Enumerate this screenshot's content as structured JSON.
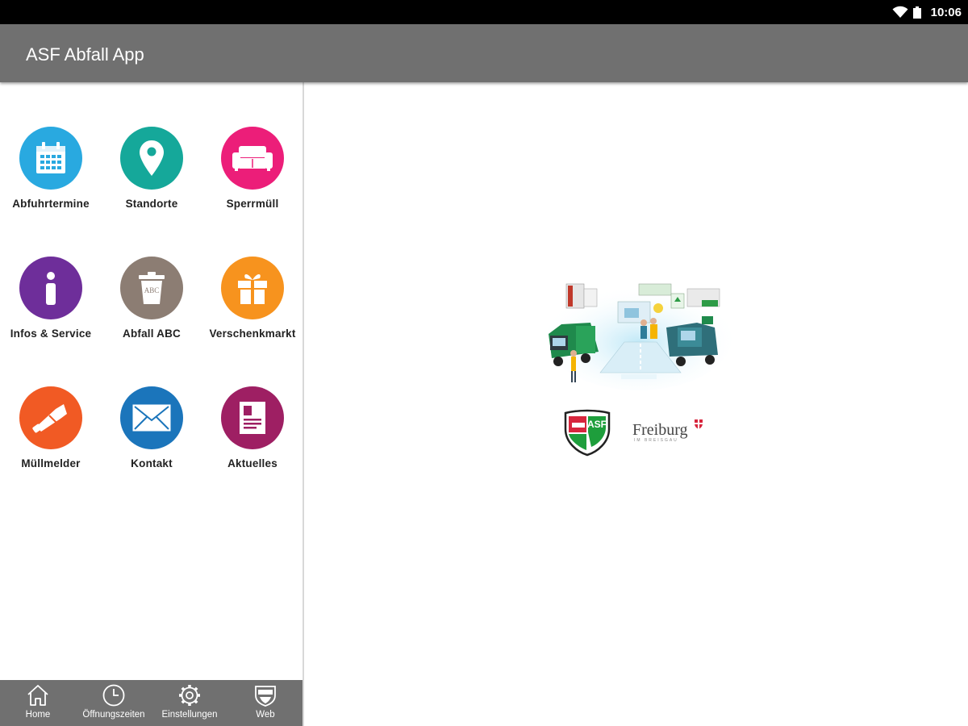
{
  "status_bar": {
    "time": "10:06",
    "icons": [
      "wifi-icon",
      "battery-icon"
    ]
  },
  "app_bar": {
    "title": "ASF Abfall App"
  },
  "menu": {
    "tiles": [
      {
        "label": "Abfuhrtermine",
        "icon": "calendar-icon",
        "color": "#29A9E0"
      },
      {
        "label": "Standorte",
        "icon": "location-pin-icon",
        "color": "#15A89A"
      },
      {
        "label": "Sperrmüll",
        "icon": "sofa-icon",
        "color": "#EC1E79"
      },
      {
        "label": "Infos & Service",
        "icon": "info-icon",
        "color": "#6E2E9A"
      },
      {
        "label": "Abfall ABC",
        "icon": "trash-bin-icon",
        "color": "#8C7D73"
      },
      {
        "label": "Verschenkmarkt",
        "icon": "gift-icon",
        "color": "#F7931E"
      },
      {
        "label": "Müllmelder",
        "icon": "megaphone-icon",
        "color": "#F15A24"
      },
      {
        "label": "Kontakt",
        "icon": "envelope-icon",
        "color": "#1B75BB"
      },
      {
        "label": "Aktuelles",
        "icon": "document-icon",
        "color": "#9E1F63"
      }
    ],
    "trash_bin_text": "ABC"
  },
  "bottom_nav": [
    {
      "label": "Home",
      "icon": "home-icon"
    },
    {
      "label": "Öffnungszeiten",
      "icon": "clock-icon"
    },
    {
      "label": "Einstellungen",
      "icon": "gear-icon"
    },
    {
      "label": "Web",
      "icon": "shield-icon"
    }
  ],
  "main": {
    "illustration": "city-waste-illustration",
    "logos": {
      "asf_text": "ASF",
      "freiburg_text": "Freiburg",
      "freiburg_sub": "IM BREISGAU"
    }
  },
  "colors": {
    "app_bar": "#707070",
    "status_bar": "#000000",
    "asf_green": "#1E9E3C",
    "asf_red": "#D7263D"
  }
}
